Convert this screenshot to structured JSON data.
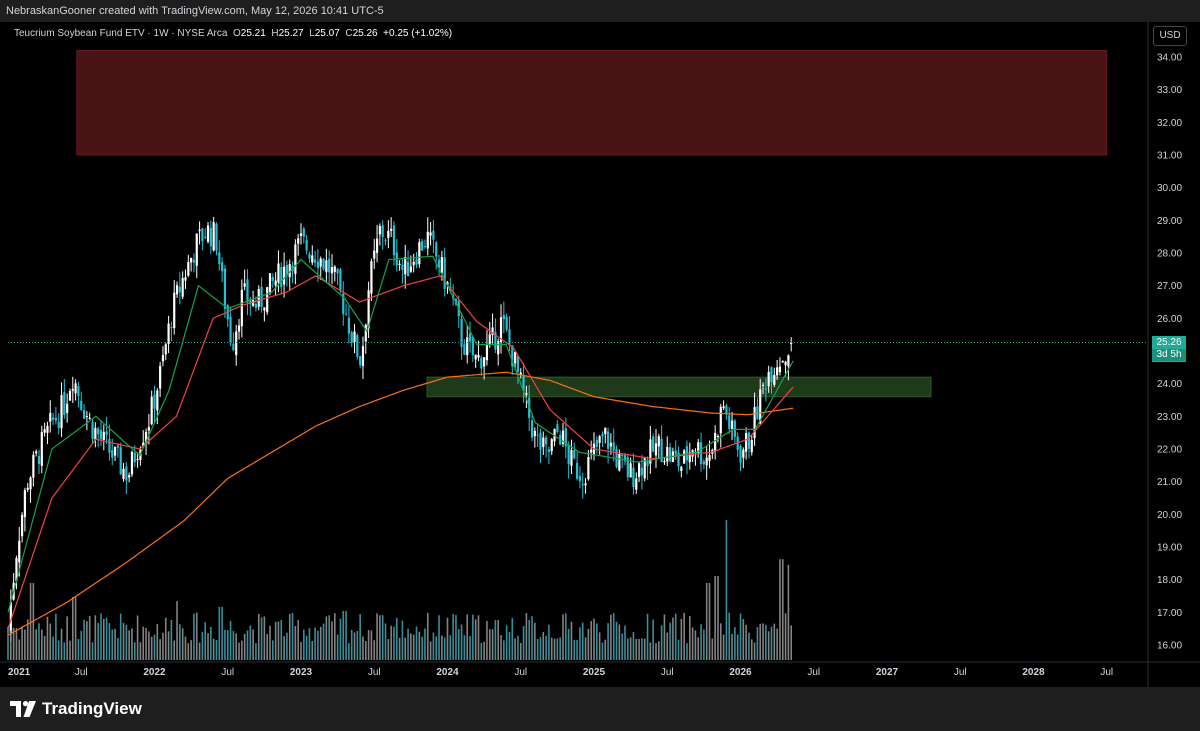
{
  "header": {
    "attribution": "NebraskanGooner created with TradingView.com, May 12, 2026 10:41 UTC-5"
  },
  "legend": {
    "symbol": "Teucrium Soybean Fund ETV · 1W · NYSE Arca",
    "open_label": "O",
    "open": "25.21",
    "high_label": "H",
    "high": "25.27",
    "low_label": "L",
    "low": "25.07",
    "close_label": "C",
    "close": "25.26",
    "change": "+0.25 (+1.02%)"
  },
  "currency_button": "USD",
  "last_price": {
    "value": "25.26",
    "countdown": "3d 5h"
  },
  "footer": {
    "brand": "TradingView"
  },
  "colors": {
    "up": "#ffffff",
    "down": "#22c2d6",
    "ema_fast": "#16a34a",
    "ema_mid": "#ef4444",
    "ema_slow": "#f97316",
    "resistance_zone": "#4a1417",
    "support_zone": "#1e3a1a"
  },
  "chart_data": {
    "type": "candlestick",
    "title": "",
    "y_ticks": [
      "34.00",
      "33.00",
      "32.00",
      "31.00",
      "30.00",
      "29.00",
      "28.00",
      "27.00",
      "26.00",
      "25.00",
      "24.00",
      "23.00",
      "22.00",
      "21.00",
      "20.00",
      "19.00",
      "18.00",
      "17.00",
      "16.00"
    ],
    "ylim": [
      15.75,
      34.35
    ],
    "x_ticks": [
      "2021",
      "Jul",
      "2022",
      "Jul",
      "2023",
      "Jul",
      "2024",
      "Jul",
      "2025",
      "Jul",
      "2026",
      "Jul",
      "2027",
      "Jul",
      "2028",
      "Jul"
    ],
    "x_tick_years": [
      2021.0,
      2021.5,
      2022.0,
      2022.5,
      2023.0,
      2023.5,
      2024.0,
      2024.5,
      2025.0,
      2025.5,
      2026.0,
      2026.5,
      2027.0,
      2027.5,
      2028.0,
      2028.5
    ],
    "xlim": [
      2021.0,
      2028.6
    ],
    "zones": [
      {
        "name": "resistance",
        "t0": 2021.47,
        "t1": 2028.5,
        "y0": 31.0,
        "y1": 34.2
      },
      {
        "name": "support",
        "t0": 2023.86,
        "t1": 2027.3,
        "y0": 23.6,
        "y1": 24.2
      }
    ],
    "price_keypoints": [
      [
        2021.0,
        16.5
      ],
      [
        2021.06,
        19.0
      ],
      [
        2021.13,
        21.0
      ],
      [
        2021.22,
        22.0
      ],
      [
        2021.3,
        22.8
      ],
      [
        2021.38,
        23.3
      ],
      [
        2021.44,
        24.3
      ],
      [
        2021.5,
        23.5
      ],
      [
        2021.56,
        22.8
      ],
      [
        2021.65,
        22.2
      ],
      [
        2021.75,
        21.6
      ],
      [
        2021.82,
        21.2
      ],
      [
        2021.9,
        22.3
      ],
      [
        2021.97,
        23.0
      ],
      [
        2022.05,
        24.5
      ],
      [
        2022.12,
        26.2
      ],
      [
        2022.2,
        27.3
      ],
      [
        2022.28,
        28.2
      ],
      [
        2022.35,
        28.7
      ],
      [
        2022.42,
        28.5
      ],
      [
        2022.47,
        26.8
      ],
      [
        2022.53,
        25.2
      ],
      [
        2022.6,
        26.7
      ],
      [
        2022.7,
        26.4
      ],
      [
        2022.8,
        27.0
      ],
      [
        2022.9,
        27.6
      ],
      [
        2023.0,
        28.3
      ],
      [
        2023.1,
        28.0
      ],
      [
        2023.2,
        27.5
      ],
      [
        2023.28,
        26.6
      ],
      [
        2023.36,
        25.3
      ],
      [
        2023.41,
        24.7
      ],
      [
        2023.46,
        26.9
      ],
      [
        2023.54,
        28.7
      ],
      [
        2023.62,
        28.4
      ],
      [
        2023.7,
        27.4
      ],
      [
        2023.78,
        28.0
      ],
      [
        2023.86,
        28.5
      ],
      [
        2023.95,
        27.6
      ],
      [
        2024.03,
        26.6
      ],
      [
        2024.1,
        25.3
      ],
      [
        2024.2,
        24.7
      ],
      [
        2024.3,
        25.2
      ],
      [
        2024.37,
        25.9
      ],
      [
        2024.45,
        24.8
      ],
      [
        2024.52,
        23.6
      ],
      [
        2024.6,
        22.3
      ],
      [
        2024.68,
        21.8
      ],
      [
        2024.76,
        22.6
      ],
      [
        2024.84,
        21.6
      ],
      [
        2024.92,
        21.2
      ],
      [
        2025.0,
        21.9
      ],
      [
        2025.08,
        22.4
      ],
      [
        2025.18,
        21.5
      ],
      [
        2025.26,
        21.2
      ],
      [
        2025.35,
        21.7
      ],
      [
        2025.44,
        22.1
      ],
      [
        2025.52,
        21.8
      ],
      [
        2025.6,
        21.5
      ],
      [
        2025.68,
        22.2
      ],
      [
        2025.76,
        21.7
      ],
      [
        2025.82,
        22.2
      ],
      [
        2025.88,
        23.4
      ],
      [
        2025.94,
        22.5
      ],
      [
        2026.0,
        21.9
      ],
      [
        2026.06,
        22.3
      ],
      [
        2026.12,
        23.3
      ],
      [
        2026.18,
        24.3
      ],
      [
        2026.25,
        24.7
      ],
      [
        2026.31,
        24.9
      ],
      [
        2026.36,
        25.26
      ]
    ],
    "ema_fast_keypoints": [
      [
        2021.0,
        17.0
      ],
      [
        2021.3,
        22.0
      ],
      [
        2021.6,
        23.0
      ],
      [
        2021.9,
        21.8
      ],
      [
        2022.1,
        23.8
      ],
      [
        2022.3,
        27.0
      ],
      [
        2022.5,
        26.3
      ],
      [
        2022.8,
        26.8
      ],
      [
        2023.0,
        27.8
      ],
      [
        2023.3,
        26.6
      ],
      [
        2023.45,
        25.6
      ],
      [
        2023.6,
        27.8
      ],
      [
        2023.9,
        27.9
      ],
      [
        2024.2,
        25.2
      ],
      [
        2024.4,
        25.2
      ],
      [
        2024.6,
        22.8
      ],
      [
        2024.9,
        21.9
      ],
      [
        2025.3,
        21.6
      ],
      [
        2025.7,
        21.9
      ],
      [
        2025.95,
        22.6
      ],
      [
        2026.1,
        22.6
      ],
      [
        2026.36,
        24.7
      ]
    ],
    "ema_mid_keypoints": [
      [
        2021.0,
        16.5
      ],
      [
        2021.3,
        20.5
      ],
      [
        2021.6,
        22.3
      ],
      [
        2021.9,
        22.0
      ],
      [
        2022.15,
        23.0
      ],
      [
        2022.4,
        26.0
      ],
      [
        2022.6,
        26.4
      ],
      [
        2022.9,
        26.8
      ],
      [
        2023.1,
        27.3
      ],
      [
        2023.4,
        26.5
      ],
      [
        2023.7,
        27.0
      ],
      [
        2023.95,
        27.3
      ],
      [
        2024.2,
        25.9
      ],
      [
        2024.45,
        25.1
      ],
      [
        2024.7,
        23.2
      ],
      [
        2025.0,
        22.0
      ],
      [
        2025.4,
        21.7
      ],
      [
        2025.8,
        21.9
      ],
      [
        2026.05,
        22.3
      ],
      [
        2026.36,
        23.9
      ]
    ],
    "ema_slow_keypoints": [
      [
        2021.0,
        16.3
      ],
      [
        2021.4,
        17.3
      ],
      [
        2021.8,
        18.5
      ],
      [
        2022.2,
        19.8
      ],
      [
        2022.5,
        21.1
      ],
      [
        2022.8,
        21.9
      ],
      [
        2023.1,
        22.7
      ],
      [
        2023.4,
        23.3
      ],
      [
        2023.7,
        23.8
      ],
      [
        2024.0,
        24.2
      ],
      [
        2024.4,
        24.35
      ],
      [
        2024.7,
        24.1
      ],
      [
        2025.0,
        23.6
      ],
      [
        2025.4,
        23.3
      ],
      [
        2025.8,
        23.1
      ],
      [
        2026.05,
        23.05
      ],
      [
        2026.36,
        23.25
      ]
    ],
    "volume_spikes": [
      [
        2021.16,
        0.55
      ],
      [
        2021.45,
        0.45
      ],
      [
        2022.15,
        0.42
      ],
      [
        2022.45,
        0.38
      ],
      [
        2023.3,
        0.35
      ],
      [
        2023.55,
        0.32
      ],
      [
        2024.3,
        0.22
      ],
      [
        2025.3,
        0.15
      ],
      [
        2025.78,
        0.55
      ],
      [
        2025.84,
        0.6
      ],
      [
        2025.9,
        1.0
      ],
      [
        2026.28,
        0.72
      ],
      [
        2026.33,
        0.68
      ]
    ]
  }
}
